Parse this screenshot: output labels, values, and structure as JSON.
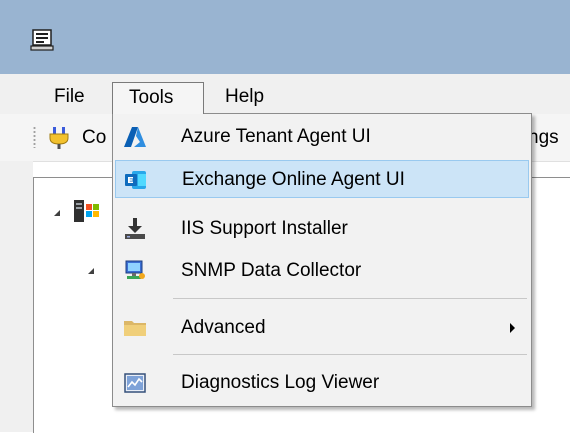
{
  "menubar": {
    "file": "File",
    "tools": "Tools",
    "help": "Help"
  },
  "toolbar": {
    "connect_partial": "Co",
    "settings_partial": "ngs"
  },
  "tools_menu": {
    "items": [
      {
        "label": "Azure Tenant Agent UI",
        "icon": "azure-icon"
      },
      {
        "label": "Exchange Online Agent UI",
        "icon": "exchange-icon",
        "hovered": true
      },
      {
        "label": "IIS Support Installer",
        "icon": "installer-icon"
      },
      {
        "label": "SNMP Data Collector",
        "icon": "snmp-icon"
      },
      {
        "label": "Advanced",
        "icon": "folder-icon",
        "has_submenu": true
      },
      {
        "label": "Diagnostics Log Viewer",
        "icon": "log-viewer-icon"
      }
    ]
  },
  "colors": {
    "title_bar": "#99b4d1",
    "hover_bg": "#cce4f7",
    "hover_border": "#99c9ef",
    "menu_bg": "#f2f2f2"
  }
}
